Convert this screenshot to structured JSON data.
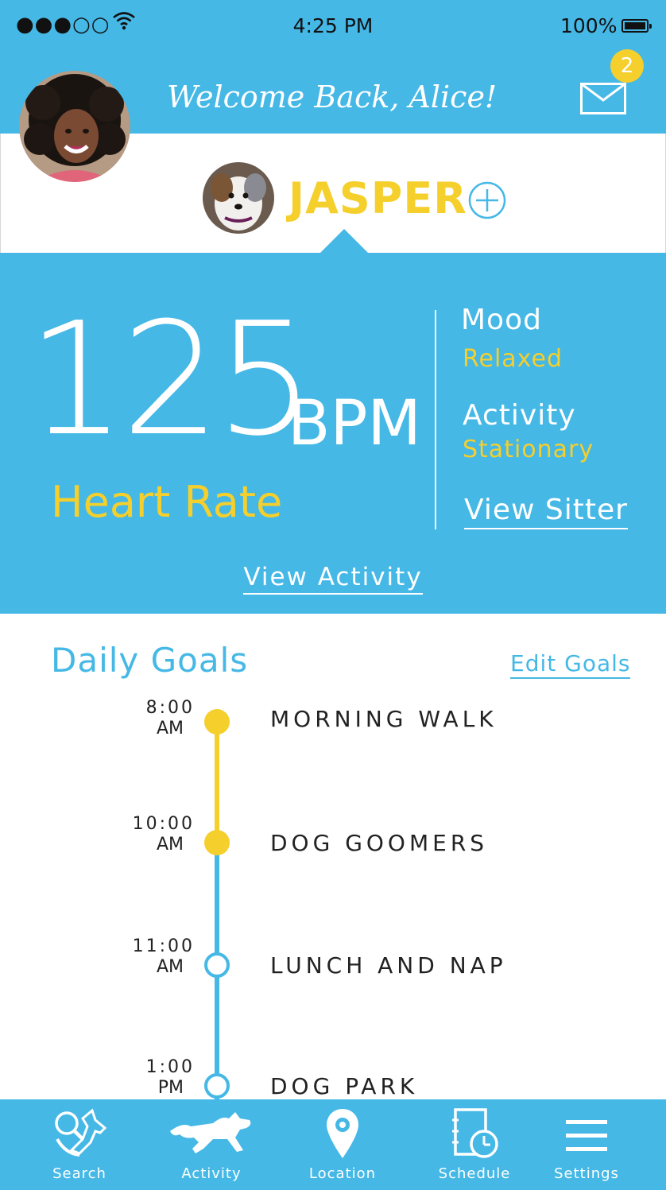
{
  "status_bar": {
    "signal": "●●●○○",
    "time": "4:25 PM",
    "battery": "100%"
  },
  "header": {
    "welcome": "Welcome Back, Alice!",
    "mail_count": "2"
  },
  "pet": {
    "name": "JASPER"
  },
  "stats": {
    "heart_value": "125",
    "heart_unit": "BPM",
    "heart_label": "Heart Rate",
    "mood_label": "Mood",
    "mood_value": "Relaxed",
    "activity_label": "Activity",
    "activity_value": "Stationary",
    "view_sitter": "View Sitter",
    "view_activity": "View Activity"
  },
  "goals": {
    "title": "Daily Goals",
    "edit": "Edit Goals",
    "items": [
      {
        "time": "8:00",
        "ampm": "AM",
        "title": "MORNING WALK",
        "done": true
      },
      {
        "time": "10:00",
        "ampm": "AM",
        "title": "DOG GOOMERS",
        "done": true
      },
      {
        "time": "11:00",
        "ampm": "AM",
        "title": "LUNCH AND NAP",
        "done": false
      },
      {
        "time": "1:00",
        "ampm": "PM",
        "title": "DOG PARK",
        "done": false
      }
    ]
  },
  "tabs": [
    {
      "label": "Search",
      "icon": "dog-search-icon"
    },
    {
      "label": "Activity",
      "icon": "running-dog-icon"
    },
    {
      "label": "Location",
      "icon": "location-pin-icon"
    },
    {
      "label": "Schedule",
      "icon": "schedule-icon"
    },
    {
      "label": "Settings",
      "icon": "menu-icon"
    }
  ],
  "colors": {
    "primary": "#45b8e6",
    "accent": "#f5cf2c"
  }
}
